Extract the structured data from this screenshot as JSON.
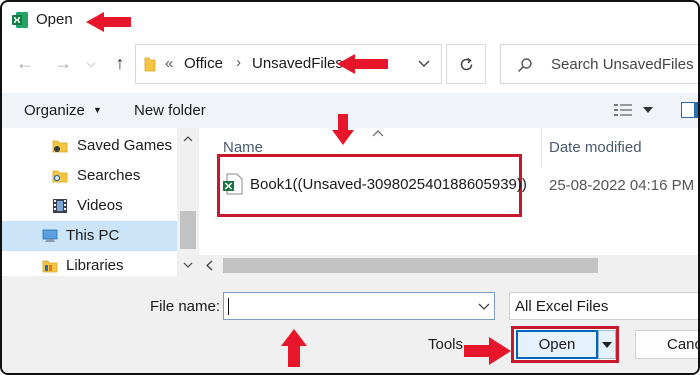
{
  "window": {
    "title": "Open"
  },
  "address": {
    "crumb_sep_left": "«",
    "crumb_1": "Office",
    "crumb_sep": "›",
    "crumb_2": "UnsavedFiles"
  },
  "search": {
    "placeholder": "Search UnsavedFiles"
  },
  "toolbar": {
    "organize": "Organize",
    "new_folder": "New folder"
  },
  "sidebar": {
    "items": [
      {
        "label": "Saved Games",
        "icon": "folder-icon"
      },
      {
        "label": "Searches",
        "icon": "search-folder-icon"
      },
      {
        "label": "Videos",
        "icon": "video-icon"
      },
      {
        "label": "This PC",
        "icon": "computer-icon",
        "selected": true
      },
      {
        "label": "Libraries",
        "icon": "library-icon"
      }
    ]
  },
  "columns": {
    "name": "Name",
    "date_modified": "Date modified"
  },
  "files": [
    {
      "name": "Book1((Unsaved-309802540188605939))",
      "date_modified": "25-08-2022 04:16 PM",
      "icon": "excel-file-icon"
    }
  ],
  "footer": {
    "file_name_label": "File name:",
    "file_name_value": "",
    "file_type": "All Excel Files",
    "tools": "Tools",
    "open": "Open",
    "cancel": "Cancel"
  },
  "colors": {
    "highlight_red": "#c8182c",
    "arrow_red": "#e8162a",
    "excel_green": "#1e7145",
    "selection_blue": "#cce4f7"
  }
}
